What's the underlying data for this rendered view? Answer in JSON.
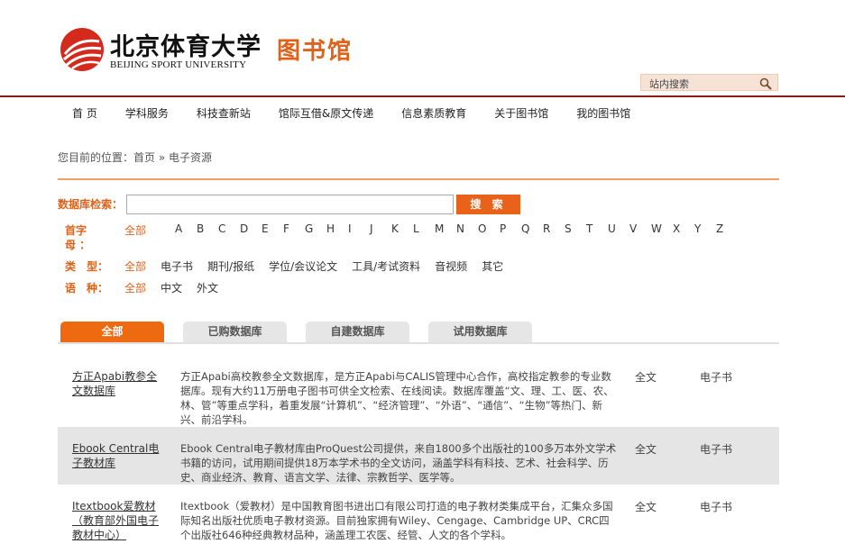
{
  "header": {
    "logo_cn": "北京体育大学",
    "logo_en": "BEIJING SPORT UNIVERSITY",
    "library": "图书馆",
    "site_search_placeholder": "站内搜索",
    "accent": "#e0621a",
    "brand_red": "#8b1a1a"
  },
  "nav": [
    "首 页",
    "学科服务",
    "科技查新站",
    "馆际互借&原文传递",
    "信息素质教育",
    "关于图书馆",
    "我的图书馆"
  ],
  "breadcrumb": "您目前的位置：首页 » 电子资源",
  "db_search": {
    "label": "数据库检索：",
    "value": "",
    "button": "搜 索"
  },
  "filters": {
    "letter_label_1": "首字",
    "letter_label_2": "母 ：",
    "letters": [
      "全部",
      "A",
      "B",
      "C",
      "D",
      "E",
      "F",
      "G",
      "H",
      "I",
      "J",
      "K",
      "L",
      "M",
      "N",
      "O",
      "P",
      "Q",
      "R",
      "S",
      "T",
      "U",
      "V",
      "W",
      "X",
      "Y",
      "Z"
    ],
    "type_label": "类　型：",
    "types": [
      "全部",
      "电子书",
      "期刊/报纸",
      "学位/会议论文",
      "工具/考试资料",
      "音视频",
      "其它"
    ],
    "lang_label": "语　种：",
    "langs": [
      "全部",
      "中文",
      "外文"
    ]
  },
  "tabs": [
    "全部",
    "已购数据库",
    "自建数据库",
    "试用数据库"
  ],
  "databases": [
    {
      "name": "方正Apabi教参全文数据库",
      "desc": "方正Apabi高校教参全文数据库，是方正Apabi与CALIS管理中心合作，高校指定教参的专业数据库。现有大约11万册电子图书可供全文检索、在线阅读。数据库覆盖“文、理、工、医、农、林、管”等重点学科，着重发展“计算机”、“经济管理”、“外语”、“通信”、“生物”等热门、新兴、前沿学科。",
      "kind": "全文",
      "format": "电子书"
    },
    {
      "name": "Ebook Central电子教材库",
      "desc": "Ebook Central电子教材库由ProQuest公司提供，来自1800多个出版社的100多万本外文学术书籍的访问，试用期间提供18万本学术书的全文访问，涵盖学科有科技、艺术、社会科学、历史、商业经济、教育、语言文学、法律、宗教哲学、医学等。",
      "kind": "全文",
      "format": "电子书"
    },
    {
      "name": "Itextbook爱教材（教育部外国电子教材中心）",
      "desc": "Itextbook（爱教材）是中国教育图书进出口有限公司打造的电子教材类集成平台，汇集众多国际知名出版社优质电子教材资源。目前独家拥有Wiley、Cengage、Cambridge UP、CRC四个出版社646种经典教材品种，涵盖理工农医、经管、人文的各个学科。",
      "kind": "全文",
      "format": "电子书"
    }
  ]
}
